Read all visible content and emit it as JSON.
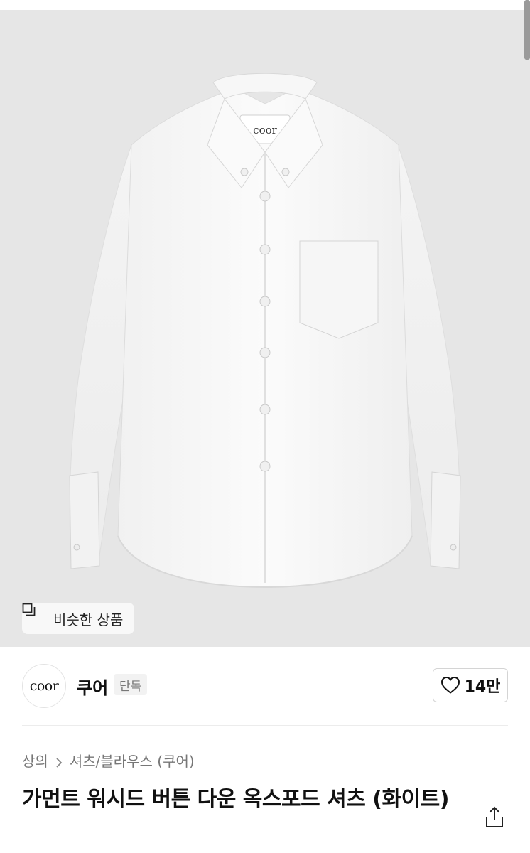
{
  "hero": {
    "collar_label": "coor",
    "similar_button_label": "비슷한 상품"
  },
  "brand": {
    "logo_text": "coor",
    "name": "쿠어",
    "badge": "단독"
  },
  "like": {
    "count": "14만"
  },
  "breadcrumb": {
    "category": "상의",
    "subcategory": "셔츠/블라우스 (쿠어)"
  },
  "product": {
    "title": "가먼트 워시드 버튼 다운 옥스포드 셔츠 (화이트)"
  },
  "icons": {
    "similar": "similar-products-icon",
    "like": "heart-outline-icon",
    "share": "share-icon",
    "breadcrumb_sep": "chevron-right-icon"
  },
  "colors": {
    "hero_background": "#e6e6e6",
    "text_primary": "#111111",
    "text_secondary": "#777777"
  }
}
